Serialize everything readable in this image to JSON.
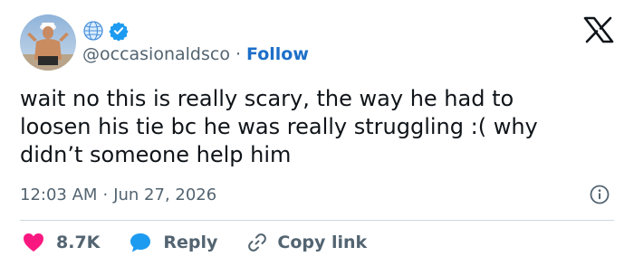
{
  "tweet": {
    "handle": "@occasionaldsco",
    "separator": "·",
    "follow_label": "Follow",
    "text": "wait no this is really scary, the way he had to\nloosen his tie bc he was really struggling :( why\ndidn’t someone help him",
    "time": "12:03 AM",
    "date": "Jun 27, 2026"
  },
  "actions": {
    "likes_count": "8.7K",
    "reply_label": "Reply",
    "copy_link_label": "Copy link"
  },
  "icons": {
    "avatar": "avatar-photo",
    "badge": "globe-icon",
    "verified": "verified-badge-icon",
    "brand": "x-logo-icon",
    "info": "info-icon",
    "like": "heart-icon",
    "reply": "speech-bubble-icon",
    "copy": "link-icon"
  },
  "colors": {
    "text": "#0f1419",
    "secondary": "#536471",
    "follow": "#1d6fc8",
    "verified": "#1d9bf0",
    "like": "#f91880",
    "reply": "#1d9bf0",
    "divider": "#cfd9de"
  }
}
